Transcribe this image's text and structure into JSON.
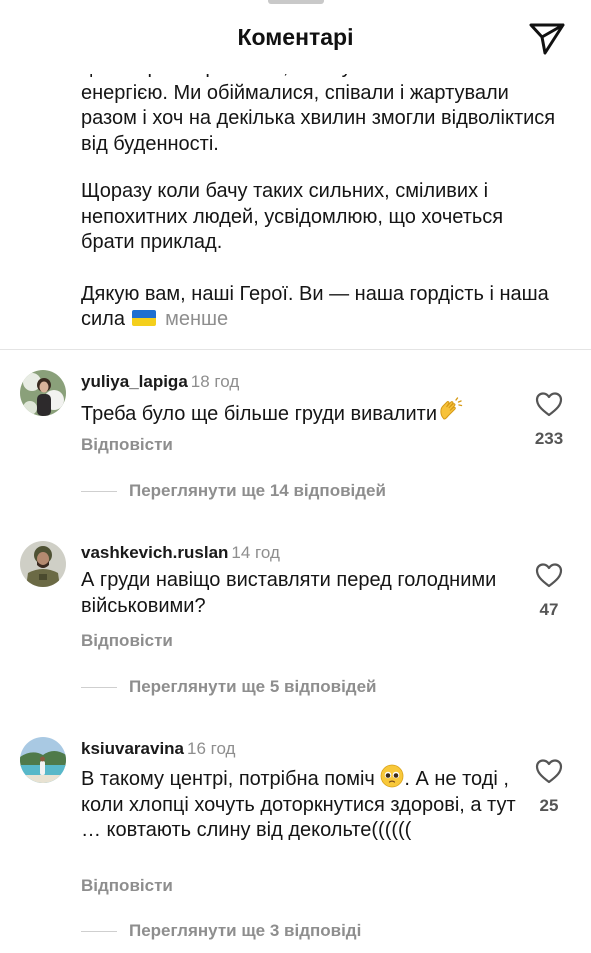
{
  "header": {
    "title": "Коментарі"
  },
  "caption": {
    "line_cut": "це не просто розмова, а потужний обмін",
    "paragraph_1_rest": "енергією. Ми обіймалися, співали і жартували разом і хоч на декілька хвилин змогли відволіктися від буденності.",
    "paragraph_2": "Щоразу коли бачу таких сильних, сміливих і непохитних людей, усвідомлюю, що хочеться брати приклад.",
    "paragraph_3": "Дякую вам, наші Герої. Ви — наша гордість і наша сила",
    "less_label": "менше"
  },
  "colors": {
    "flag_blue": "#1f6fd1",
    "flag_yellow": "#f4cf1c",
    "muted_text": "#8e8e8e"
  },
  "comments": [
    {
      "username": "yuliya_lapiga",
      "time": "18 год",
      "text": "Треба було ще більше груди вивалити",
      "emoji": "clapping-hands",
      "reply_label": "Відповісти",
      "likes": "233",
      "more_replies": "Переглянути ще 14 відповідей"
    },
    {
      "username": "vashkevich.ruslan",
      "time": "14 год",
      "text": "А груди навіщо виставляти перед голодними військовими?",
      "reply_label": "Відповісти",
      "likes": "47",
      "more_replies": "Переглянути ще 5 відповідей"
    },
    {
      "username": "ksiuvaravina",
      "time": "16 год",
      "text_before_emoji": "В такому центрі, потрібна поміч",
      "emoji": "pleading-face",
      "text_after_emoji": ". А не тоді , коли хлопці хочуть доторкнутися здорові, а тут … ковтають слину від декольте((((((",
      "reply_label": "Відповісти",
      "likes": "25",
      "more_replies": "Переглянути ще 3 відповіді"
    }
  ]
}
